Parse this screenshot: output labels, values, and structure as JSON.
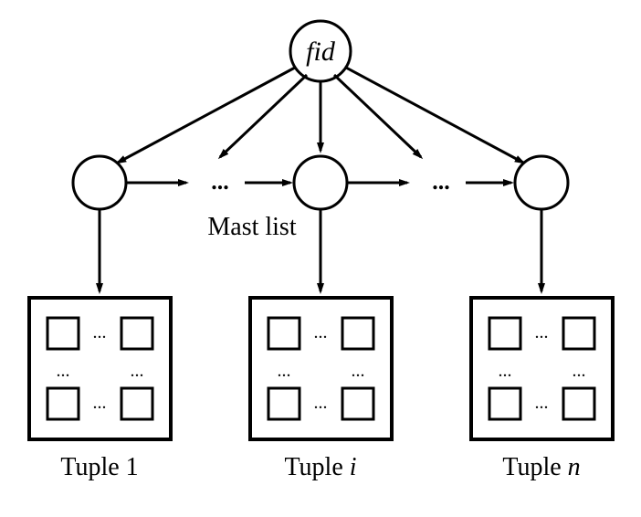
{
  "root": {
    "label": "fid"
  },
  "mastList": {
    "label": "Mast list"
  },
  "tuples": [
    {
      "label_pre": "Tuple ",
      "label_var": "1",
      "italic_var": false
    },
    {
      "label_pre": "Tuple ",
      "label_var": "i",
      "italic_var": true
    },
    {
      "label_pre": "Tuple ",
      "label_var": "n",
      "italic_var": true
    }
  ],
  "ellipsis": "..."
}
